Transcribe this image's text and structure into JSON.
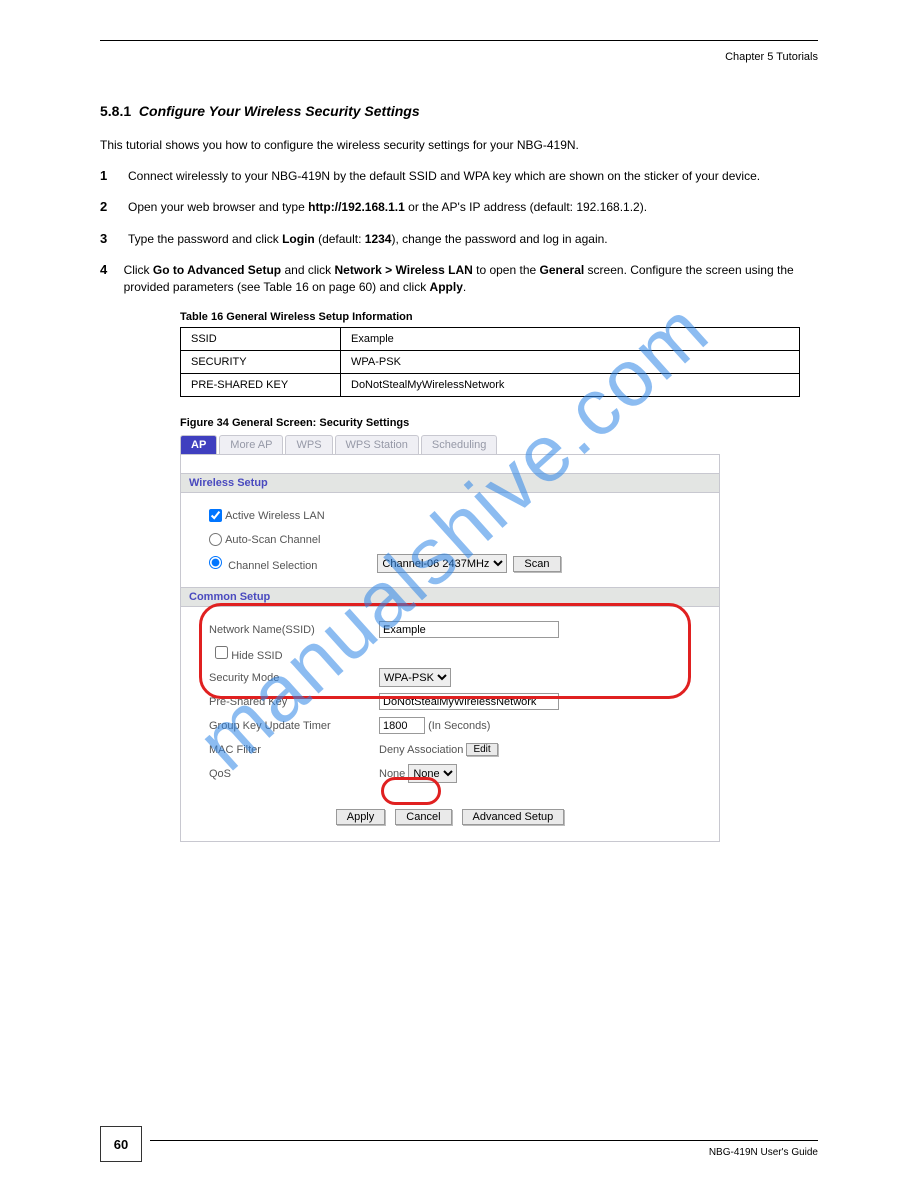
{
  "header": {
    "chapter_label": "Chapter 5 Tutorials"
  },
  "section": {
    "number": "5.8.1",
    "title": "Configure Your Wireless Security Settings"
  },
  "paras": {
    "intro": "This tutorial shows you how to configure the wireless security settings for your NBG-419N.",
    "step1": "Connect wirelessly to your NBG-419N by the default SSID and WPA key which are shown on the sticker of your device.",
    "step2_pre": "Open your web browser and type ",
    "step2_url": "http://192.168.1.1",
    "step2_post": " or the AP's IP address (default: 192.168.1.2).",
    "step3a": "Type the password and click ",
    "step3b_login": "Login",
    "step3c": " (default: ",
    "step3d_pw": "1234",
    "step3e": "), change the password and log in again.",
    "step4a": "Click ",
    "step4b": "Go to Advanced Setup",
    "step4c": " and click ",
    "step4d": "Network > Wireless LAN",
    "step4e": " to open the ",
    "step4f": "General",
    "step4g": " screen. Configure the screen using the provided parameters (see Table 16 on page 60) and click ",
    "step4h": "Apply",
    "step4i": "."
  },
  "table": {
    "caption": "Table 16   General Wireless Setup Information",
    "rows": [
      [
        "SSID",
        "Example"
      ],
      [
        "SECURITY",
        "WPA-PSK"
      ],
      [
        "PRE-SHARED KEY",
        "DoNotStealMyWirelessNetwork"
      ]
    ]
  },
  "figure": {
    "caption": "Figure 34   General Screen: Security Settings",
    "tabs": [
      "AP",
      "More AP",
      "WPS",
      "WPS Station",
      "Scheduling"
    ],
    "wireless_setup": {
      "heading": "Wireless Setup",
      "active_label": "Active Wireless LAN",
      "active_checked": true,
      "autoscan_label": "Auto-Scan Channel",
      "channel_sel_label": "Channel Selection",
      "channel_value": "Channel-06 2437MHz",
      "scan_btn": "Scan"
    },
    "common_setup": {
      "heading": "Common Setup",
      "ssid_label": "Network Name(SSID)",
      "ssid_value": "Example",
      "hide_ssid_label": "Hide SSID",
      "hide_ssid_checked": false,
      "security_mode_label": "Security Mode",
      "security_mode_value": "WPA-PSK",
      "psk_label": "Pre-Shared Key",
      "psk_value": "DoNotStealMyWirelessNetwork",
      "group_key_label": "Group Key Update Timer",
      "group_key_value": "1800",
      "group_key_unit": "(In Seconds)",
      "mac_filter_label": "MAC Filter",
      "mac_filter_status": "Deny Association",
      "mac_filter_edit": "Edit",
      "qos_label": "QoS",
      "qos_status": "None",
      "qos_value": "None"
    },
    "buttons": {
      "apply": "Apply",
      "cancel": "Cancel",
      "advanced": "Advanced Setup"
    }
  },
  "watermark": "manualshive.com",
  "footer": {
    "page_num": "60",
    "label": "NBG-419N User's Guide"
  }
}
